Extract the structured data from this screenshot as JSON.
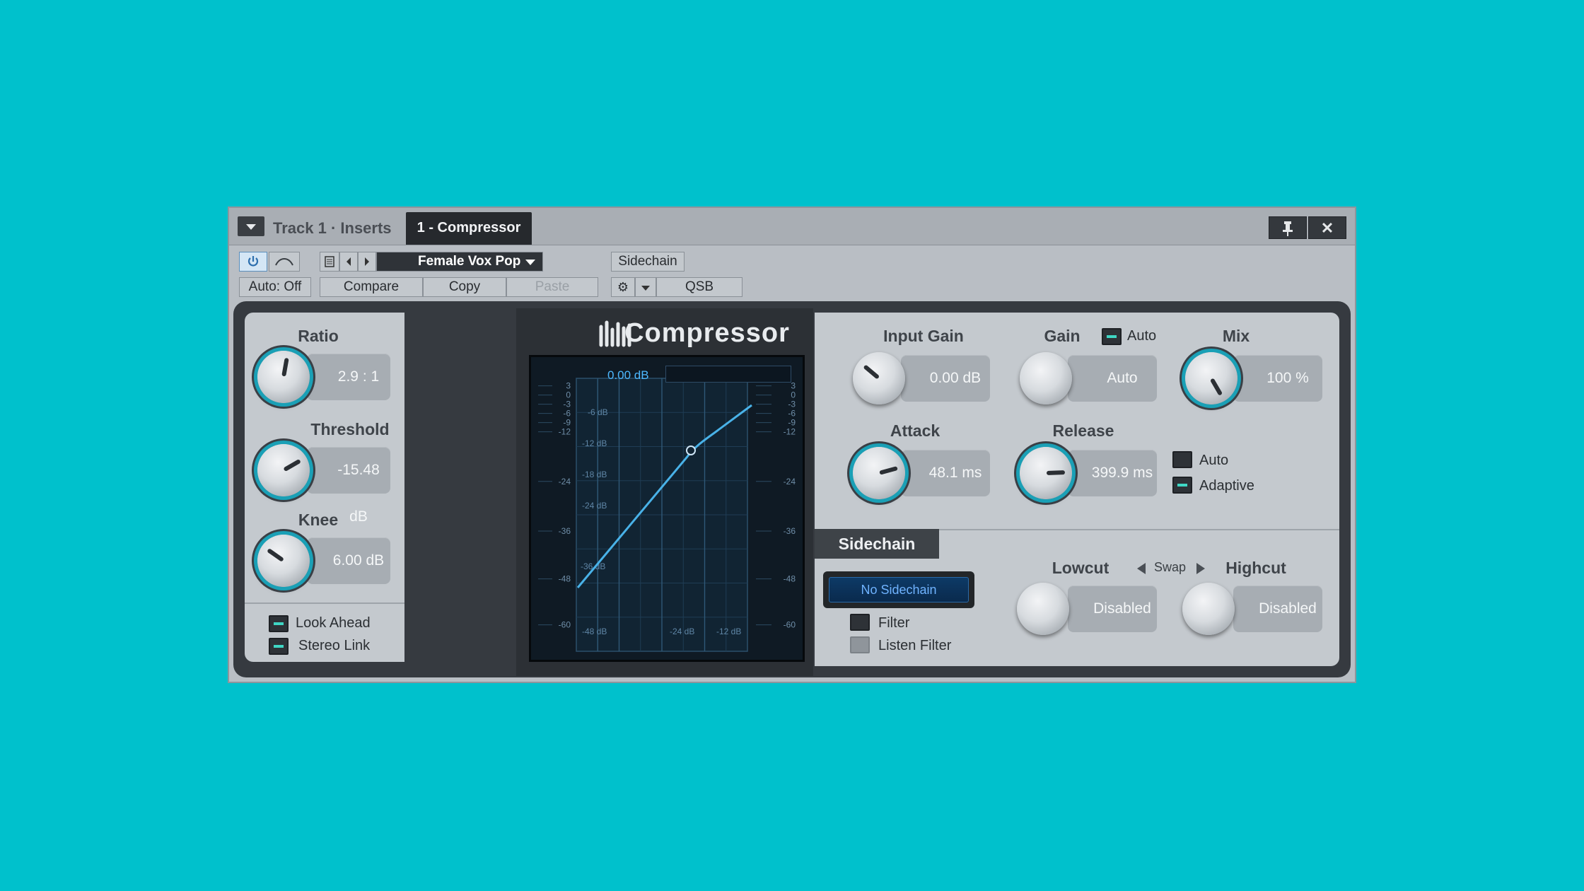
{
  "window": {
    "track_label": "Track 1 · Inserts",
    "active_tab": "1 - Compressor",
    "pin_icon": "pin-icon",
    "close_glyph": "✕"
  },
  "toolbar": {
    "preset_name": "Female Vox Pop",
    "sidechain_label": "Sidechain",
    "auto_label": "Auto: Off",
    "compare_label": "Compare",
    "copy_label": "Copy",
    "paste_label": "Paste",
    "qs_label": "QSB"
  },
  "plugin": {
    "title": "Compressor"
  },
  "left": {
    "ratio_label": "Ratio",
    "ratio_value": "2.9 : 1",
    "threshold_label": "Threshold",
    "threshold_value": "-15.48 dB",
    "knee_label": "Knee",
    "knee_value": "6.00 dB",
    "lookahead_label": "Look Ahead",
    "lookahead_on": true,
    "stereolink_label": "Stereo Link",
    "stereolink_on": true
  },
  "graph": {
    "readout": "0.00 dB",
    "left_scale": [
      "3",
      "0",
      "-3",
      "-6",
      "-9",
      "-12",
      "-24",
      "-36",
      "-48",
      "-60"
    ],
    "right_scale": [
      "3",
      "0",
      "-3",
      "-6",
      "-9",
      "-12",
      "-24",
      "-36",
      "-48",
      "-60"
    ],
    "inner_labels": [
      "-6 dB",
      "-12 dB",
      "-18 dB",
      "-24 dB",
      "-36 dB",
      "-48 dB",
      "-24 dB",
      "-12 dB"
    ]
  },
  "right": {
    "input_gain_label": "Input Gain",
    "input_gain_value": "0.00 dB",
    "gain_label": "Gain",
    "gain_auto_label": "Auto",
    "gain_value": "Auto",
    "mix_label": "Mix",
    "mix_value": "100 %",
    "attack_label": "Attack",
    "attack_value": "48.1 ms",
    "release_label": "Release",
    "release_value": "399.9 ms",
    "auto_label": "Auto",
    "adaptive_label": "Adaptive"
  },
  "sidechain": {
    "tab_label": "Sidechain",
    "source_label": "No Sidechain",
    "filter_label": "Filter",
    "listen_filter_label": "Listen Filter",
    "lowcut_label": "Lowcut",
    "lowcut_value": "Disabled",
    "swap_label": "Swap",
    "highcut_label": "Highcut",
    "highcut_value": "Disabled"
  },
  "colors": {
    "background": "#00c1cc",
    "accent": "#1aa0b6",
    "curve": "#4db8ff"
  }
}
